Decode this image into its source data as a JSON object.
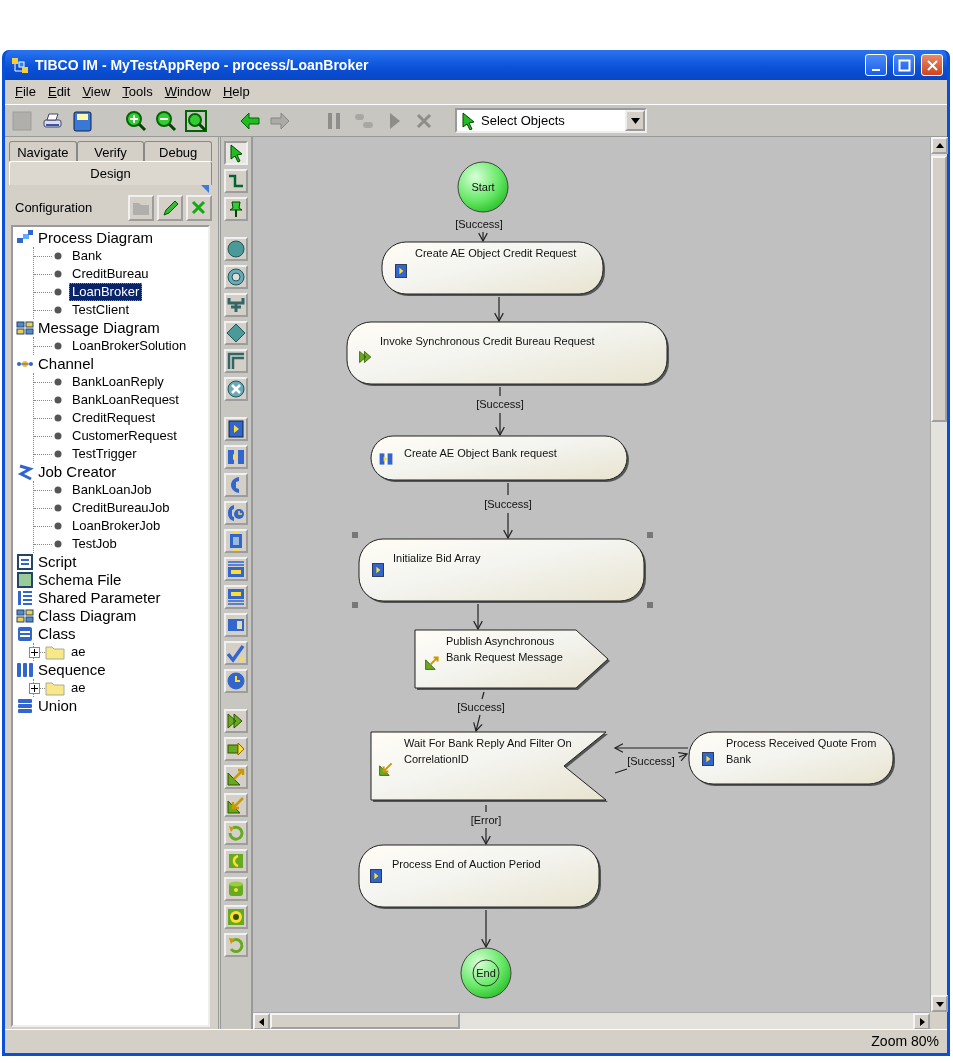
{
  "window": {
    "title": "TIBCO IM - MyTestAppRepo - process/LoanBroker"
  },
  "menu": [
    "File",
    "Edit",
    "View",
    "Tools",
    "Window",
    "Help"
  ],
  "toolbar": {
    "buttons": [
      {
        "disabled": true
      },
      {
        "disabled": false
      },
      {
        "disabled": false
      },
      {
        "disabled": false
      },
      {
        "disabled": false
      },
      {
        "disabled": false
      },
      {
        "disabled": false
      },
      {
        "disabled": true
      },
      {
        "disabled": true
      },
      {
        "disabled": true
      },
      {
        "disabled": true
      },
      {
        "disabled": true
      }
    ],
    "mode_select": {
      "value": "Select Objects"
    }
  },
  "side_panel": {
    "tabs": [
      {
        "label": "Navigate",
        "selected": false
      },
      {
        "label": "Verify",
        "selected": false
      },
      {
        "label": "Debug",
        "selected": false
      },
      {
        "label": "Design",
        "selected": true
      }
    ],
    "configuration": {
      "label": "Configuration",
      "buttons": [
        {
          "disabled": true
        },
        {
          "disabled": false
        },
        {
          "disabled": false
        }
      ]
    },
    "tree": [
      {
        "label": "Process Diagram",
        "selected": false,
        "children": [
          {
            "label": "Bank",
            "selected": false
          },
          {
            "label": "CreditBureau",
            "selected": false
          },
          {
            "label": "LoanBroker",
            "selected": true
          },
          {
            "label": "TestClient",
            "selected": false
          }
        ]
      },
      {
        "label": "Message Diagram",
        "selected": false,
        "children": [
          {
            "label": "LoanBrokerSolution",
            "selected": false
          }
        ]
      },
      {
        "label": "Channel",
        "selected": false,
        "children": [
          {
            "label": "BankLoanReply",
            "selected": false
          },
          {
            "label": "BankLoanRequest",
            "selected": false
          },
          {
            "label": "CreditRequest",
            "selected": false
          },
          {
            "label": "CustomerRequest",
            "selected": false
          },
          {
            "label": "TestTrigger",
            "selected": false
          }
        ]
      },
      {
        "label": "Job Creator",
        "selected": false,
        "children": [
          {
            "label": "BankLoanJob",
            "selected": false
          },
          {
            "label": "CreditBureauJob",
            "selected": false
          },
          {
            "label": "LoanBrokerJob",
            "selected": false
          },
          {
            "label": "TestJob",
            "selected": false
          }
        ]
      },
      {
        "label": "Script",
        "selected": false
      },
      {
        "label": "Schema File",
        "selected": false
      },
      {
        "label": "Shared Parameter",
        "selected": false
      },
      {
        "label": "Class Diagram",
        "selected": false
      },
      {
        "label": "Class",
        "selected": false,
        "children": [
          {
            "label": "ae",
            "kind": "folder",
            "expanded": false,
            "selected": false
          }
        ]
      },
      {
        "label": "Sequence",
        "selected": false,
        "children": [
          {
            "label": "ae",
            "kind": "folder",
            "expanded": false,
            "selected": false
          }
        ]
      },
      {
        "label": "Union",
        "selected": false
      }
    ]
  },
  "palette": [
    {
      "selected": true
    },
    {
      "selected": false
    },
    {
      "selected": false
    },
    {
      "selected": false
    },
    {
      "selected": false
    },
    {
      "selected": false
    },
    {
      "selected": false
    },
    {
      "selected": false
    },
    {
      "selected": false
    },
    {
      "selected": false
    },
    {
      "selected": false
    },
    {
      "selected": false
    },
    {
      "selected": false
    },
    {
      "selected": false
    },
    {
      "selected": false
    },
    {
      "selected": false
    },
    {
      "selected": false
    },
    {
      "selected": false
    },
    {
      "selected": false
    },
    {
      "selected": false
    },
    {
      "selected": false
    },
    {
      "selected": false
    },
    {
      "selected": false
    },
    {
      "selected": false
    },
    {
      "selected": false
    },
    {
      "selected": false
    },
    {
      "selected": false
    },
    {
      "selected": false
    }
  ],
  "diagram": {
    "nodes": [
      {
        "kind": "start",
        "label": "Start",
        "selected": false
      },
      {
        "kind": "activity",
        "label": "Create AE Object Credit Request",
        "selected": false,
        "incoming_label": "[Success]"
      },
      {
        "kind": "activity",
        "label": "Invoke Synchronous Credit Bureau Request",
        "selected": false
      },
      {
        "kind": "activity",
        "label": "Create AE Object Bank request",
        "selected": false,
        "incoming_label": "[Success]"
      },
      {
        "kind": "activity",
        "label": "Initialize Bid Array",
        "selected": true,
        "incoming_label": "[Success]"
      },
      {
        "kind": "send",
        "label": "Publish Asynchronous Bank Request Message",
        "selected": false
      },
      {
        "kind": "receive",
        "label": "Wait For Bank Reply And Filter On CorrelationID",
        "selected": false,
        "incoming_label": "[Success]"
      },
      {
        "kind": "activity",
        "label": "Process Received Quote From Bank",
        "selected": false,
        "incoming_label": "[Success]"
      },
      {
        "kind": "activity",
        "label": "Process End of Auction Period",
        "selected": false,
        "incoming_label": "[Error]"
      },
      {
        "kind": "end",
        "label": "End",
        "selected": false
      }
    ]
  },
  "status_bar": {
    "zoom": "Zoom 80%"
  }
}
